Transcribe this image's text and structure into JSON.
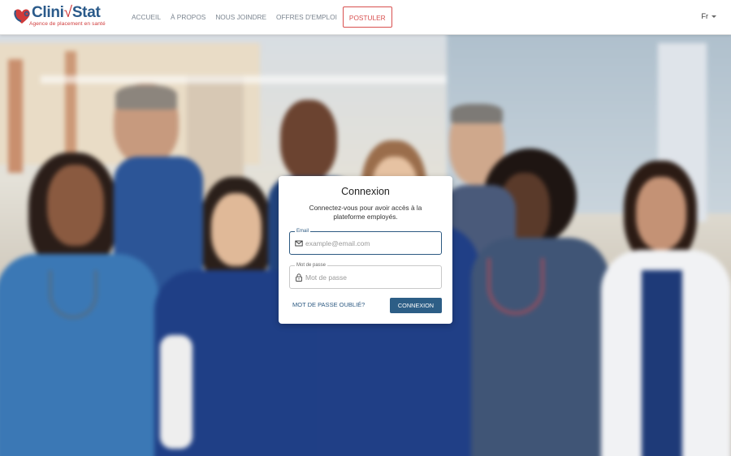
{
  "header": {
    "logo": {
      "name_left": "Clini",
      "name_sep": "√",
      "name_right": "Stat",
      "tagline": "Agence de placement en santé"
    },
    "nav": [
      "ACCUEIL",
      "À PROPOS",
      "NOUS JOINDRE",
      "OFFRES D'EMPLOI"
    ],
    "cta": "POSTULER",
    "language": "Fr"
  },
  "login": {
    "title": "Connexion",
    "subtitle": "Connectez-vous pour avoir accès à la plateforme employés.",
    "email_label": "Email",
    "email_placeholder": "example@email.com",
    "password_label": "Mot de passe",
    "password_placeholder": "Mot de passe",
    "forgot": "MOT DE PASSE OUBLIÉ?",
    "submit": "CONNEXION"
  },
  "colors": {
    "brand_blue": "#2a5a8a",
    "brand_red": "#d03a3a",
    "button": "#2d5e86",
    "scrub_blue": "#2c5596"
  },
  "icons": {
    "logo": "heart-stethoscope-icon",
    "email": "envelope-icon",
    "password": "lock-icon",
    "language": "caret-down-icon"
  }
}
